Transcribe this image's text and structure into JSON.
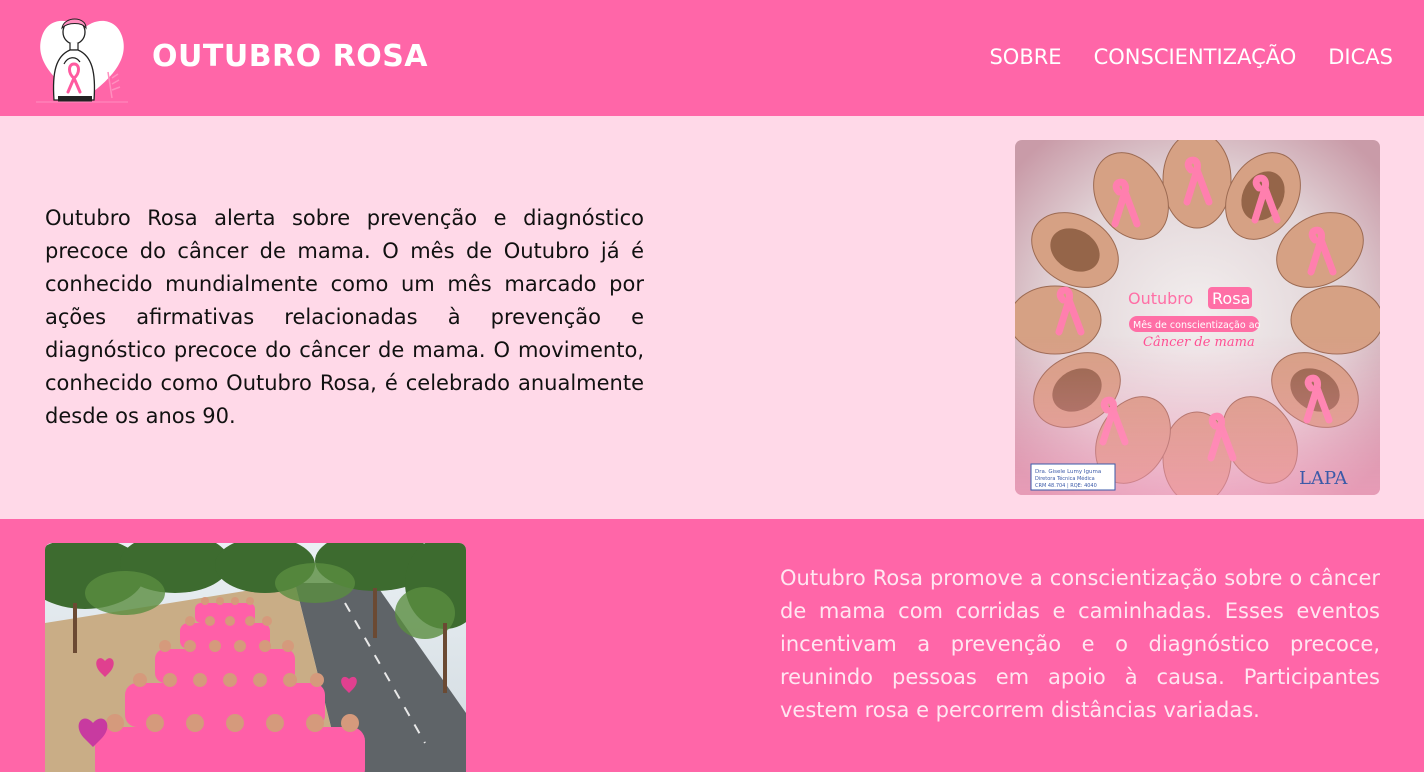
{
  "header": {
    "brand": "OUTUBRO ROSA",
    "nav": [
      "SOBRE",
      "CONSCIENTIZAÇÃO",
      "DICAS"
    ]
  },
  "section1": {
    "text": "Outubro Rosa alerta sobre prevenção e diagnóstico precoce do câncer de mama. O mês de Outubro já é conhecido mundialmente como um mês marcado por ações afirmativas relacionadas à prevenção e diagnóstico precoce do câncer de mama. O movimento, conhecido como Outubro Rosa, é celebrado anualmente desde os anos 90.",
    "image": {
      "title_a": "Outubro",
      "title_b": "Rosa",
      "subtitle": "Mês de conscientização ao",
      "script_line": "Câncer de mama",
      "doctor_line1": "Dra. Gisele Lumy Iguma",
      "doctor_line2": "Diretora Técnica Médica",
      "doctor_line3": "CRM 48.704 | RQE: 4040",
      "lab_logo": "LAPA"
    }
  },
  "section2": {
    "text": "Outubro Rosa promove a conscientização sobre o câncer de mama com corridas e caminhadas. Esses eventos incentivam a prevenção e o diagnóstico precoce, reunindo pessoas em apoio à causa. Participantes vestem rosa e percorrem distâncias variadas."
  },
  "colors": {
    "header_bg": "#ff66a8",
    "section1_bg": "#ffd9e8",
    "section2_bg": "#ff66a8",
    "text_dark": "#111111",
    "text_light": "#ffe6f1"
  },
  "icons": [
    "outubro-rosa-logo-illustration"
  ]
}
